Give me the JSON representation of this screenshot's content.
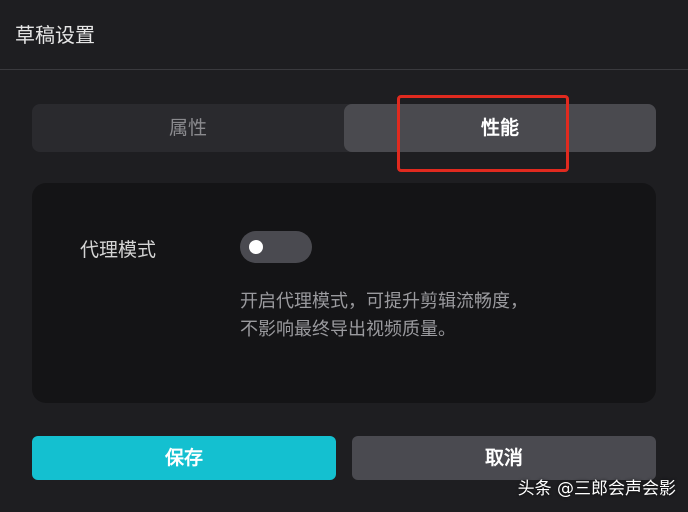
{
  "dialog": {
    "title": "草稿设置"
  },
  "tabs": [
    {
      "label": "属性",
      "active": false
    },
    {
      "label": "性能",
      "active": true
    }
  ],
  "panel": {
    "proxy_mode_label": "代理模式",
    "proxy_mode_enabled": false,
    "description_line1": "开启代理模式，可提升剪辑流畅度，",
    "description_line2": "不影响最终导出视频质量。"
  },
  "buttons": {
    "save_label": "保存",
    "cancel_label": "取消"
  },
  "watermark": {
    "text": "头条 @三郎会声会影"
  },
  "colors": {
    "background": "#1e1e21",
    "panel": "#141416",
    "accent": "#14c0d0",
    "highlight": "#e02a1f",
    "toggle_off": "#4a4a50"
  }
}
